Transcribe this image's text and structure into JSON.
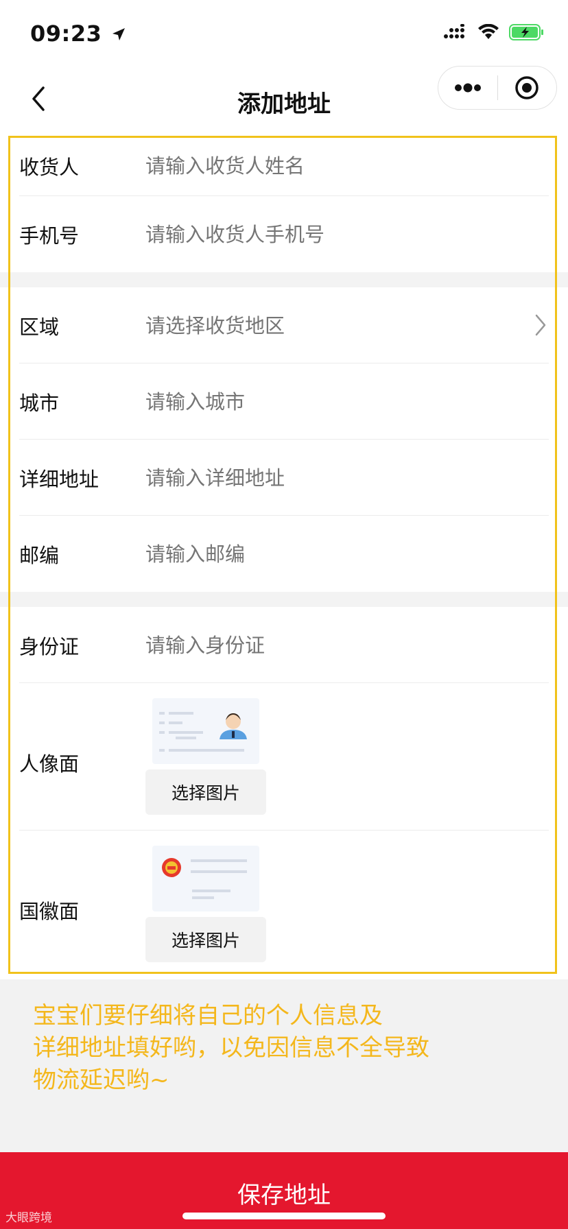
{
  "status_bar": {
    "time": "09:23",
    "battery_color": "#4cd964"
  },
  "nav": {
    "title": "添加地址",
    "back_icon": "chevron-left-icon",
    "more_icon": "more-dots-icon",
    "close_icon": "target-circle-icon"
  },
  "form": {
    "consignee": {
      "label": "收货人",
      "placeholder": "请输入收货人姓名"
    },
    "phone": {
      "label": "手机号",
      "placeholder": "请输入收货人手机号"
    },
    "region": {
      "label": "区域",
      "placeholder": "请选择收货地区"
    },
    "city": {
      "label": "城市",
      "placeholder": "请输入城市"
    },
    "address": {
      "label": "详细地址",
      "placeholder": "请输入详细地址"
    },
    "zipcode": {
      "label": "邮编",
      "placeholder": "请输入邮编"
    },
    "id_number": {
      "label": "身份证",
      "placeholder": "请输入身份证"
    },
    "id_front": {
      "label": "人像面",
      "button": "选择图片"
    },
    "id_back": {
      "label": "国徽面",
      "button": "选择图片"
    }
  },
  "notice": {
    "lines": [
      "宝宝们要仔细将自己的个人信息及",
      "详细地址填好哟，以免因信息不全导致",
      "物流延迟哟~"
    ],
    "color": "#f4b71c"
  },
  "footer": {
    "save_label": "保存地址",
    "watermark": "大眼跨境",
    "color": "#e4172e"
  },
  "colors": {
    "frame": "#f1c21b"
  }
}
